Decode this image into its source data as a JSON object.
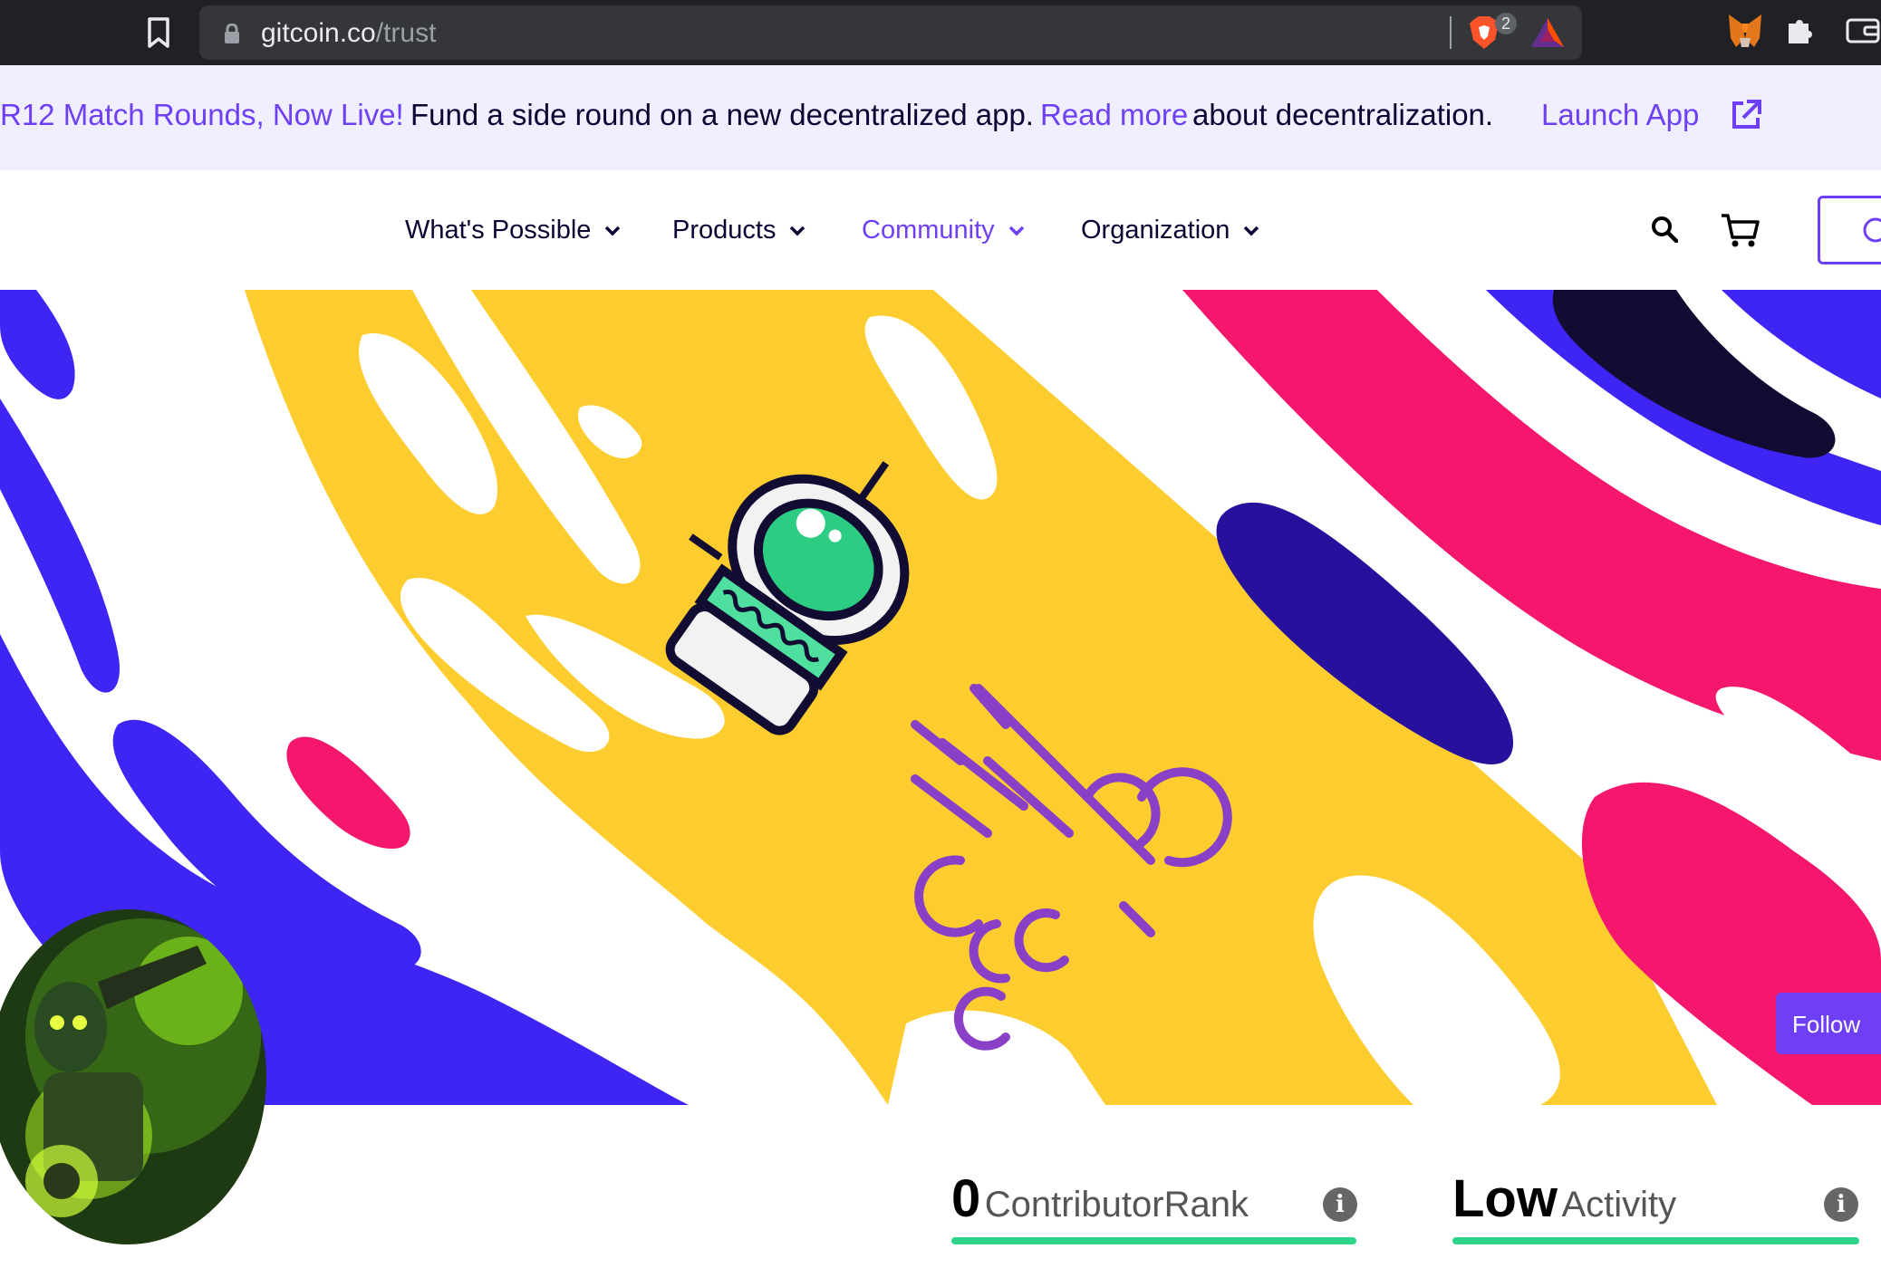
{
  "browser": {
    "url_domain": "gitcoin.co",
    "url_path": "/trust",
    "shield_count": "2",
    "icons": [
      "bookmark-icon",
      "lock-icon",
      "brave-shield-icon",
      "bat-rewards-icon",
      "metamask-fox-icon",
      "extensions-puzzle-icon",
      "wallet-icon"
    ]
  },
  "banner": {
    "announcement_link": "R12 Match Rounds, Now Live!",
    "message": "Fund a side round on a new decentralized app.",
    "read_more_link": "Read more",
    "read_more_tail": "about decentralization.",
    "launch_app": "Launch App"
  },
  "nav": {
    "items": [
      {
        "label": "What's Possible",
        "active": false
      },
      {
        "label": "Products",
        "active": false
      },
      {
        "label": "Community",
        "active": true
      },
      {
        "label": "Organization",
        "active": false
      }
    ]
  },
  "profile": {
    "follow_label": "Follow",
    "contributor_rank_value": "0",
    "contributor_rank_label": "ContributorRank",
    "activity_value": "Low",
    "activity_label": "Activity"
  },
  "colors": {
    "accent_purple": "#6f3ff5",
    "banner_bg": "#efefff",
    "hero_yellow": "#fdcd30",
    "hero_blue": "#3f25f3",
    "hero_pink": "#f4176d",
    "hero_navy": "#27109b",
    "rank_bar_green": "#2dd48a"
  }
}
